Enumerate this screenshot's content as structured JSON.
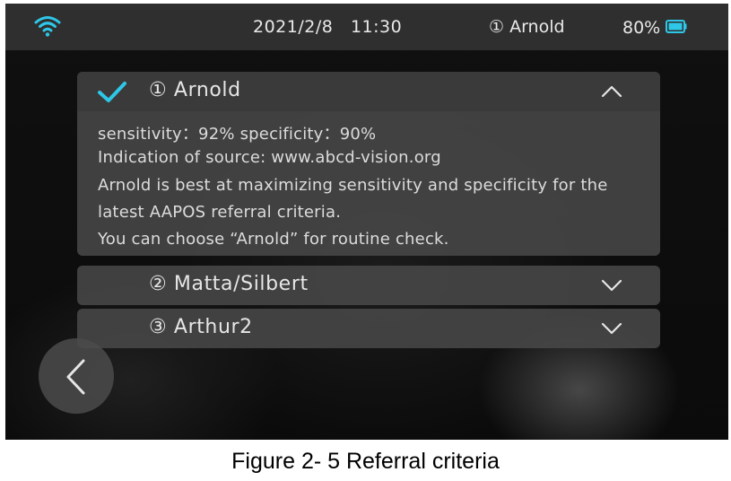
{
  "status_bar": {
    "wifi_icon": "wifi-icon",
    "datetime": "2021/2/8   11:30",
    "user": "① Arnold",
    "battery_level": "80%",
    "battery_icon": "battery-icon",
    "accent_color": "#2ec7e8"
  },
  "criteria": [
    {
      "label": "① Arnold",
      "selected": true,
      "expanded": true,
      "details": {
        "line1": "sensitivity：92%  specificity：90%",
        "line2": "Indication of source:   www.abcd-vision.org",
        "line3": "Arnold is best at maximizing sensitivity and specificity for the",
        "line4": "latest AAPOS referral criteria.",
        "line5": "You can choose   “Arnold”   for routine check."
      }
    },
    {
      "label": "② Matta/Silbert",
      "selected": false,
      "expanded": false
    },
    {
      "label": "③ Arthur2",
      "selected": false,
      "expanded": false
    }
  ],
  "back_icon": "chevron-left-icon",
  "caption": "Figure 2- 5 Referral criteria"
}
